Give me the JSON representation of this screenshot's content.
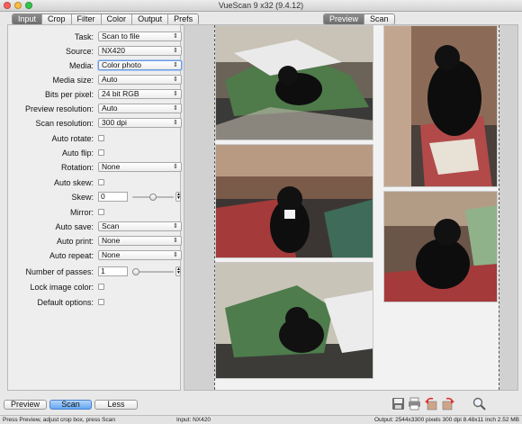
{
  "window": {
    "title": "VueScan 9 x32 (9.4.12)"
  },
  "tabs_left": [
    {
      "label": "Input",
      "active": true
    },
    {
      "label": "Crop",
      "active": false
    },
    {
      "label": "Filter",
      "active": false
    },
    {
      "label": "Color",
      "active": false
    },
    {
      "label": "Output",
      "active": false
    },
    {
      "label": "Prefs",
      "active": false
    }
  ],
  "tabs_right": [
    {
      "label": "Preview",
      "active": true
    },
    {
      "label": "Scan",
      "active": false
    }
  ],
  "settings": {
    "task": {
      "label": "Task:",
      "value": "Scan to file"
    },
    "source": {
      "label": "Source:",
      "value": "NX420"
    },
    "media": {
      "label": "Media:",
      "value": "Color photo"
    },
    "media_size": {
      "label": "Media size:",
      "value": "Auto"
    },
    "bits_per_pixel": {
      "label": "Bits per pixel:",
      "value": "24 bit RGB"
    },
    "preview_resolution": {
      "label": "Preview resolution:",
      "value": "Auto"
    },
    "scan_resolution": {
      "label": "Scan resolution:",
      "value": "300 dpi"
    },
    "auto_rotate": {
      "label": "Auto rotate:",
      "checked": false
    },
    "auto_flip": {
      "label": "Auto flip:",
      "checked": false
    },
    "rotation": {
      "label": "Rotation:",
      "value": "None"
    },
    "auto_skew": {
      "label": "Auto skew:",
      "checked": false
    },
    "skew": {
      "label": "Skew:",
      "value": "0",
      "slider_fraction": 0.5
    },
    "mirror": {
      "label": "Mirror:",
      "checked": false
    },
    "auto_save": {
      "label": "Auto save:",
      "value": "Scan"
    },
    "auto_print": {
      "label": "Auto print:",
      "value": "None"
    },
    "auto_repeat": {
      "label": "Auto repeat:",
      "value": "None"
    },
    "number_of_passes": {
      "label": "Number of passes:",
      "value": "1",
      "slider_fraction": 0.0
    },
    "lock_image_color": {
      "label": "Lock image color:",
      "checked": false
    },
    "default_options": {
      "label": "Default options:",
      "checked": false
    }
  },
  "buttons": {
    "preview": "Preview",
    "scan": "Scan",
    "less": "Less"
  },
  "toolbar_icons": [
    "save-icon",
    "print-icon",
    "rotate-left-icon",
    "rotate-right-icon",
    "zoom-icon"
  ],
  "status": {
    "left": "Press Preview, adjust crop box, press Scan",
    "middle": "Input: NX420",
    "right": "Output: 2544x3300 pixels 300 dpi 8.48x11 inch 2.52 MB"
  },
  "colors": {
    "accent": "#62a7f4",
    "active_tab": "#7a7a7a",
    "preview_bg": "#d1d1d1"
  }
}
